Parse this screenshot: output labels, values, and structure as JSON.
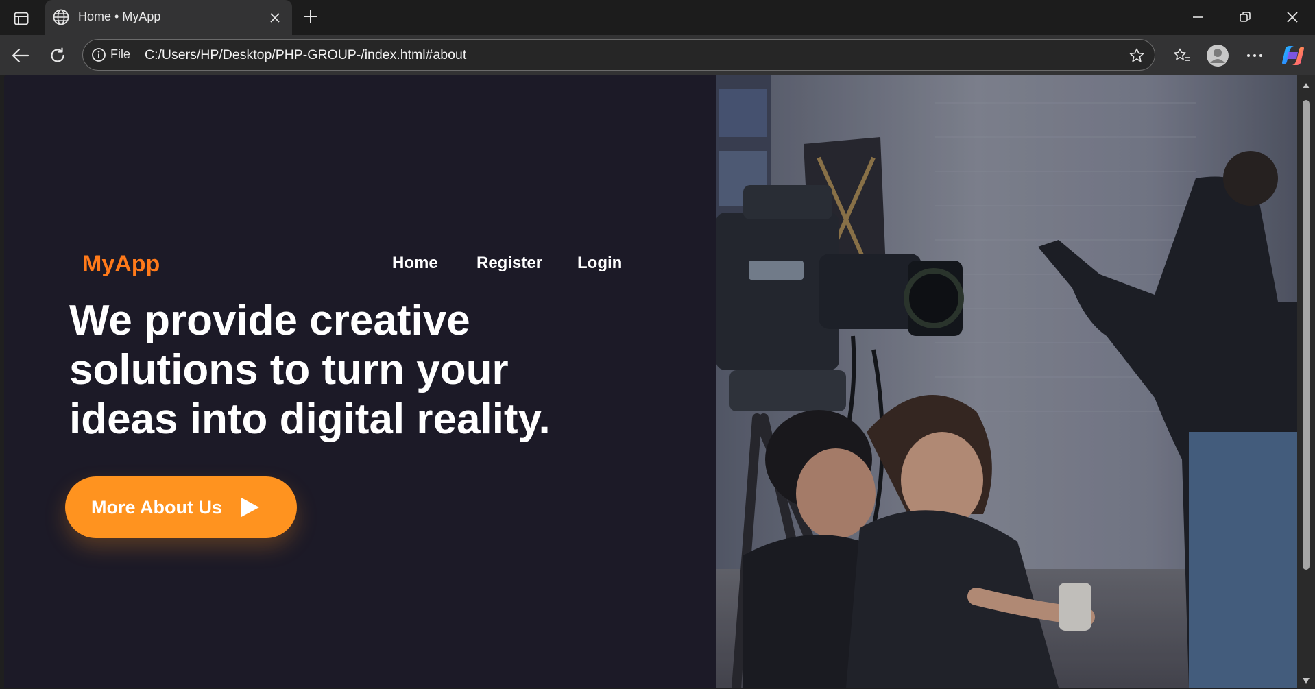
{
  "browser": {
    "tab_title": "Home • MyApp",
    "omnibox": {
      "scheme_label": "File",
      "url": "C:/Users/HP/Desktop/PHP-GROUP-/index.html#about"
    }
  },
  "site": {
    "brand": "MyApp",
    "nav": [
      {
        "label": "Home"
      },
      {
        "label": "Register"
      },
      {
        "label": "Login"
      }
    ],
    "headline_lines": [
      "We provide creative",
      "solutions to turn your",
      "ideas into digital reality."
    ],
    "cta_label": "More About Us"
  },
  "colors": {
    "page_bg": "#1c1a27",
    "brand": "#ff7a1a",
    "cta_bg": "#ff931f",
    "text": "#ffffff"
  },
  "icons": {
    "tab_sidebar": "tab-actions-icon",
    "tab_favicon": "globe-icon",
    "tab_close": "close-icon",
    "new_tab": "plus-icon",
    "back": "back-arrow-icon",
    "reload": "reload-icon",
    "site_info": "info-icon",
    "favorite": "star-icon",
    "favorites": "favorites-icon",
    "profile": "avatar-icon",
    "more": "more-icon",
    "copilot": "copilot-icon",
    "cta_arrow": "play-arrow-icon"
  }
}
